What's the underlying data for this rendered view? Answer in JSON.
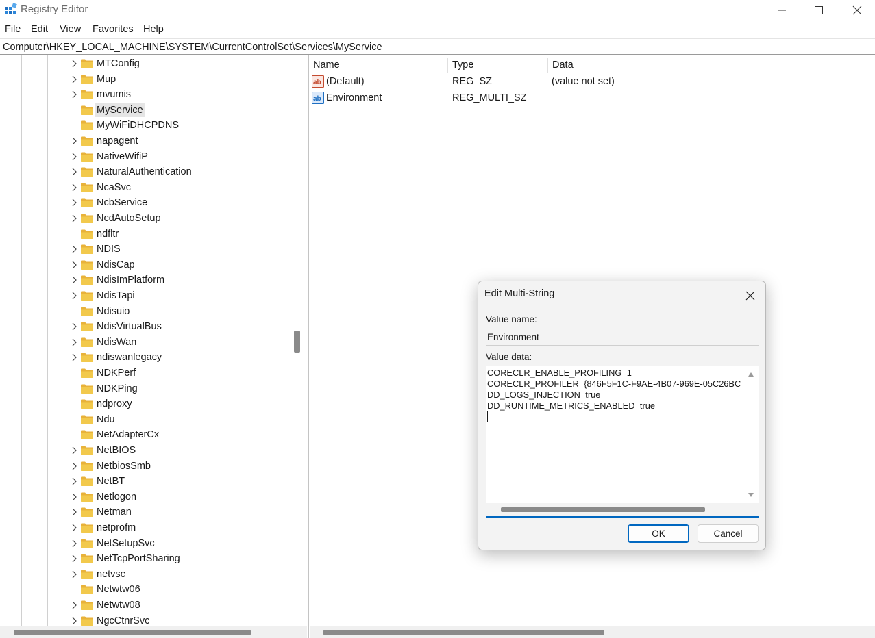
{
  "window": {
    "title": "Registry Editor",
    "controls": [
      "minimize-icon",
      "maximize-icon",
      "close-icon"
    ]
  },
  "menu": {
    "items": [
      "File",
      "Edit",
      "View",
      "Favorites",
      "Help"
    ]
  },
  "address": {
    "path": "Computer\\HKEY_LOCAL_MACHINE\\SYSTEM\\CurrentControlSet\\Services\\MyService"
  },
  "tree": {
    "selected": "MyService",
    "items": [
      {
        "label": "MTConfig",
        "expandable": true
      },
      {
        "label": "Mup",
        "expandable": true
      },
      {
        "label": "mvumis",
        "expandable": true
      },
      {
        "label": "MyService",
        "expandable": false
      },
      {
        "label": "MyWiFiDHCPDNS",
        "expandable": false
      },
      {
        "label": "napagent",
        "expandable": true
      },
      {
        "label": "NativeWifiP",
        "expandable": true
      },
      {
        "label": "NaturalAuthentication",
        "expandable": true
      },
      {
        "label": "NcaSvc",
        "expandable": true
      },
      {
        "label": "NcbService",
        "expandable": true
      },
      {
        "label": "NcdAutoSetup",
        "expandable": true
      },
      {
        "label": "ndfltr",
        "expandable": false
      },
      {
        "label": "NDIS",
        "expandable": true
      },
      {
        "label": "NdisCap",
        "expandable": true
      },
      {
        "label": "NdisImPlatform",
        "expandable": true
      },
      {
        "label": "NdisTapi",
        "expandable": true
      },
      {
        "label": "Ndisuio",
        "expandable": false
      },
      {
        "label": "NdisVirtualBus",
        "expandable": true
      },
      {
        "label": "NdisWan",
        "expandable": true
      },
      {
        "label": "ndiswanlegacy",
        "expandable": true
      },
      {
        "label": "NDKPerf",
        "expandable": false
      },
      {
        "label": "NDKPing",
        "expandable": false
      },
      {
        "label": "ndproxy",
        "expandable": false
      },
      {
        "label": "Ndu",
        "expandable": false
      },
      {
        "label": "NetAdapterCx",
        "expandable": false
      },
      {
        "label": "NetBIOS",
        "expandable": true
      },
      {
        "label": "NetbiosSmb",
        "expandable": true
      },
      {
        "label": "NetBT",
        "expandable": true
      },
      {
        "label": "Netlogon",
        "expandable": true
      },
      {
        "label": "Netman",
        "expandable": true
      },
      {
        "label": "netprofm",
        "expandable": true
      },
      {
        "label": "NetSetupSvc",
        "expandable": true
      },
      {
        "label": "NetTcpPortSharing",
        "expandable": true
      },
      {
        "label": "netvsc",
        "expandable": true
      },
      {
        "label": "Netwtw06",
        "expandable": false
      },
      {
        "label": "Netwtw08",
        "expandable": true
      },
      {
        "label": "NgcCtnrSvc",
        "expandable": true
      }
    ]
  },
  "values": {
    "headers": {
      "name": "Name",
      "type": "Type",
      "data": "Data"
    },
    "rows": [
      {
        "name": "(Default)",
        "type": "REG_SZ",
        "data": "(value not set)",
        "icon": "string-value-icon"
      },
      {
        "name": "Environment",
        "type": "REG_MULTI_SZ",
        "data": "",
        "icon": "multi-string-value-icon"
      }
    ]
  },
  "dialog": {
    "title": "Edit Multi-String",
    "value_name_label": "Value name:",
    "value_name": "Environment",
    "value_data_label": "Value data:",
    "value_data_lines": [
      "CORECLR_ENABLE_PROFILING=1",
      "CORECLR_PROFILER={846F5F1C-F9AE-4B07-969E-05C26BC",
      "DD_LOGS_INJECTION=true",
      "DD_RUNTIME_METRICS_ENABLED=true"
    ],
    "ok_label": "OK",
    "cancel_label": "Cancel"
  },
  "colors": {
    "accent": "#0067c0",
    "folder": "#f2c94c",
    "selection": "#e5e5e5"
  }
}
